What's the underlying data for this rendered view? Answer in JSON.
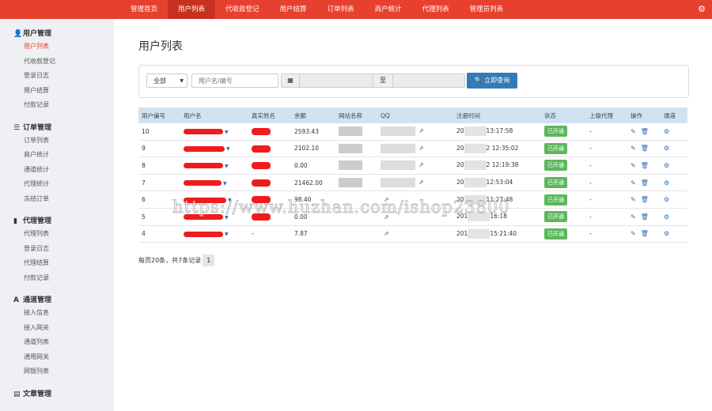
{
  "topnav": {
    "items": [
      "管理首页",
      "用户列表",
      "代收款登记",
      "用户结算",
      "订单列表",
      "商户统计",
      "代理列表",
      "管理员列表"
    ],
    "active_index": 1,
    "settings_icon": "gear-icon"
  },
  "sidebar": {
    "groups": [
      {
        "title": "用户管理",
        "icon": "user-icon",
        "items": [
          "用户列表",
          "代收款登记",
          "登录日志",
          "用户结算",
          "付款记录"
        ]
      },
      {
        "title": "订单管理",
        "icon": "list-icon",
        "items": [
          "订单列表",
          "商户统计",
          "通道统计",
          "代理统计",
          "冻结订单"
        ]
      },
      {
        "title": "代理管理",
        "icon": "file-icon",
        "items": [
          "代理列表",
          "登录日志",
          "代理结算",
          "付款记录"
        ]
      },
      {
        "title": "通道管理",
        "icon": "road-icon",
        "items": [
          "接入信息",
          "接入网关",
          "通道列表",
          "通用网关",
          "网银列表"
        ]
      },
      {
        "title": "文章管理",
        "icon": "book-icon",
        "items": []
      }
    ],
    "active_item": "用户列表"
  },
  "main": {
    "title": "用户列表",
    "search": {
      "select_value": "全部",
      "user_placeholder": "用户名/编号",
      "date_sep": "至",
      "button_label": "立即查询"
    },
    "table": {
      "headers": [
        "用户编号",
        "用户名",
        "真实姓名",
        "余额",
        "网站名称",
        "QQ",
        "注册时间",
        "状态",
        "上级代理",
        "操作",
        "通道"
      ],
      "rows": [
        {
          "id": "10",
          "real": "",
          "balance": "2593.43",
          "reg_pre": "20",
          "reg_post": "13:17:58",
          "status": "已开通",
          "agent": "-"
        },
        {
          "id": "9",
          "real": "",
          "balance": "2102.10",
          "reg_pre": "20",
          "reg_post": "2 12:35:02",
          "status": "已开通",
          "agent": "-"
        },
        {
          "id": "8",
          "real": "",
          "balance": "0.00",
          "reg_pre": "20",
          "reg_post": "2 12:19:38",
          "status": "已开通",
          "agent": "-"
        },
        {
          "id": "7",
          "real": "",
          "balance": "21462.00",
          "reg_pre": "20",
          "reg_post": "12:53:04",
          "status": "已开通",
          "agent": "-"
        },
        {
          "id": "6",
          "real": "",
          "balance": "98.40",
          "reg_pre": "20",
          "reg_post": "11:27:48",
          "status": "已开通",
          "agent": "-"
        },
        {
          "id": "5",
          "real": "",
          "balance": "0.00",
          "reg_pre": "201",
          "reg_post": "16:18",
          "status": "已开通",
          "agent": "-"
        },
        {
          "id": "4",
          "real": "-",
          "balance": "7.87",
          "reg_pre": "201",
          "reg_post": "15:21:40",
          "status": "已开通",
          "agent": "-"
        }
      ]
    },
    "pager": {
      "summary": "每页20条，共7条记录",
      "page": "1"
    },
    "watermark": "https://www.huzhan.com/ishop23800"
  },
  "colors": {
    "accent": "#e8402e",
    "primary": "#337ab7",
    "success": "#5cb85c"
  }
}
